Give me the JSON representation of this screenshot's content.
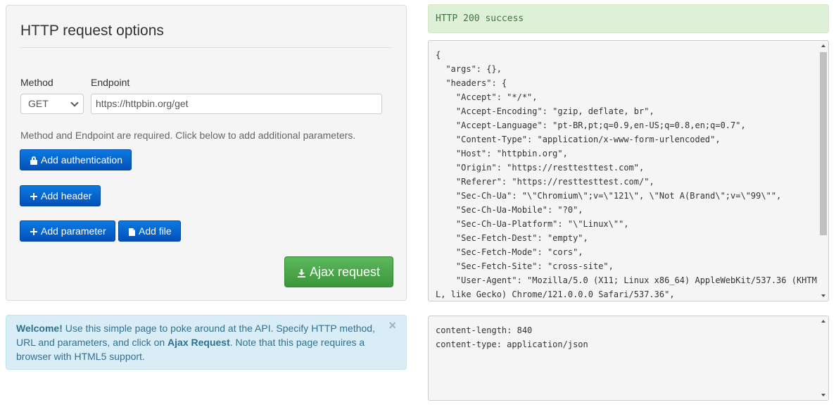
{
  "options": {
    "title": "HTTP request options",
    "method_label": "Method",
    "endpoint_label": "Endpoint",
    "method_value": "GET",
    "endpoint_value": "https://httpbin.org/get",
    "help_text": "Method and Endpoint are required. Click below to add additional parameters.",
    "buttons": {
      "add_authentication": "Add authentication",
      "add_header": "Add header",
      "add_parameter": "Add parameter",
      "add_file": "Add file",
      "ajax_request": "Ajax request"
    }
  },
  "alert": {
    "welcome": "Welcome!",
    "text_1": " Use this simple page to poke around at the API. Specify HTTP method, URL and parameters, and click on ",
    "ajax_label": "Ajax Request",
    "text_2": ". Note that this page requires a browser with HTML5 support.",
    "close": "×"
  },
  "response": {
    "status": "HTTP 200 success",
    "body": "{\n  \"args\": {},\n  \"headers\": {\n    \"Accept\": \"*/*\",\n    \"Accept-Encoding\": \"gzip, deflate, br\",\n    \"Accept-Language\": \"pt-BR,pt;q=0.9,en-US;q=0.8,en;q=0.7\",\n    \"Content-Type\": \"application/x-www-form-urlencoded\",\n    \"Host\": \"httpbin.org\",\n    \"Origin\": \"https://resttesttest.com\",\n    \"Referer\": \"https://resttesttest.com/\",\n    \"Sec-Ch-Ua\": \"\\\"Chromium\\\";v=\\\"121\\\", \\\"Not A(Brand\\\";v=\\\"99\\\"\",\n    \"Sec-Ch-Ua-Mobile\": \"?0\",\n    \"Sec-Ch-Ua-Platform\": \"\\\"Linux\\\"\",\n    \"Sec-Fetch-Dest\": \"empty\",\n    \"Sec-Fetch-Mode\": \"cors\",\n    \"Sec-Fetch-Site\": \"cross-site\",\n    \"User-Agent\": \"Mozilla/5.0 (X11; Linux x86_64) AppleWebKit/537.36 (KHTML, like Gecko) Chrome/121.0.0.0 Safari/537.36\",",
    "headers_text": "content-length: 840\ncontent-type: application/json"
  }
}
